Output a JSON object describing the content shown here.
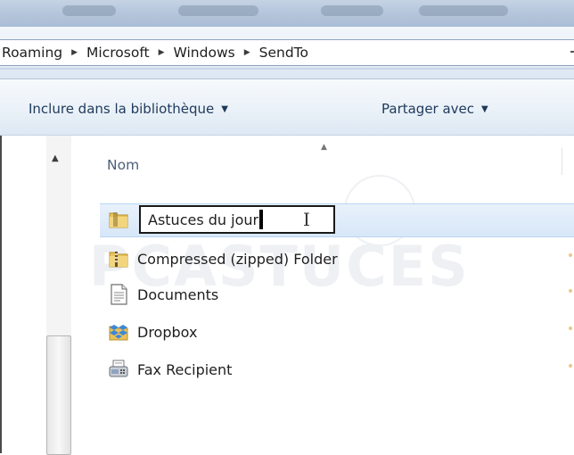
{
  "breadcrumb": [
    "Roaming",
    "Microsoft",
    "Windows",
    "SendTo"
  ],
  "toolbar": {
    "include_library_label": "Inclure dans la bibliothèque",
    "share_with_label": "Partager avec"
  },
  "file_list": {
    "column_name_header": "Nom",
    "rename_value": "Astuces du jour",
    "rows": [
      {
        "label": "Compressed (zipped) Folder",
        "icon": "zip-folder-icon"
      },
      {
        "label": "Documents",
        "icon": "document-icon"
      },
      {
        "label": "Dropbox",
        "icon": "dropbox-icon"
      },
      {
        "label": "Fax Recipient",
        "icon": "fax-icon"
      }
    ]
  },
  "watermark": "PCASTUCES"
}
